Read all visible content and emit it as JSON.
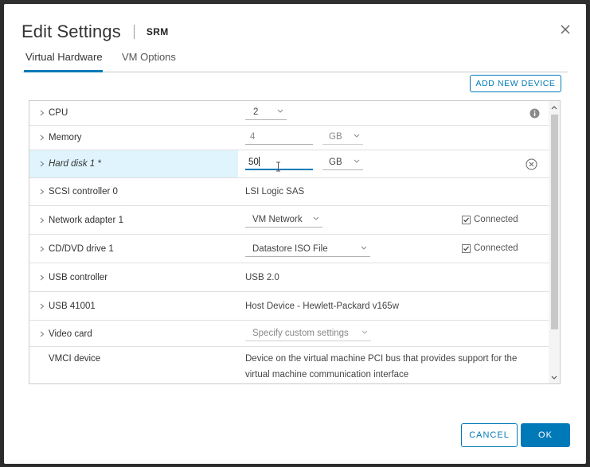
{
  "dialog": {
    "title": "Edit Settings",
    "subtitle": "SRM",
    "close_icon": "close-icon"
  },
  "tabs": [
    {
      "label": "Virtual Hardware",
      "active": true
    },
    {
      "label": "VM Options",
      "active": false
    }
  ],
  "toolbar": {
    "add_new_device": "ADD NEW DEVICE"
  },
  "hardware": {
    "cpu": {
      "label": "CPU",
      "value": "2"
    },
    "memory": {
      "label": "Memory",
      "value": "4",
      "unit": "GB"
    },
    "hard_disk": {
      "label": "Hard disk 1 *",
      "value": "50",
      "unit": "GB"
    },
    "scsi": {
      "label": "SCSI controller 0",
      "value": "LSI Logic SAS"
    },
    "network": {
      "label": "Network adapter 1",
      "value": "VM Network",
      "connected_label": "Connected",
      "connected": true
    },
    "cdrom": {
      "label": "CD/DVD drive 1",
      "value": "Datastore ISO File",
      "connected_label": "Connected",
      "connected": true
    },
    "usb_controller": {
      "label": "USB controller",
      "value": "USB 2.0"
    },
    "usb_device": {
      "label": "USB 41001",
      "value": "Host Device - Hewlett-Packard v165w"
    },
    "video": {
      "label": "Video card",
      "value": "Specify custom settings"
    },
    "vmci": {
      "label": "VMCI device",
      "value_line1": "Device on the virtual machine PCI bus that provides support for the",
      "value_line2": "virtual machine communication interface"
    }
  },
  "footer": {
    "cancel": "CANCEL",
    "ok": "OK"
  },
  "colors": {
    "accent": "#0079b8",
    "highlight_row": "#dff4fc"
  }
}
